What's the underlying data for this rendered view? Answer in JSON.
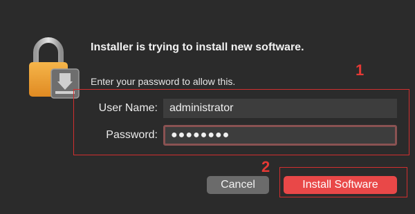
{
  "dialog": {
    "title": "Installer is trying to install new software.",
    "message": "Enter your password to allow this.",
    "icon": "lock-icon"
  },
  "form": {
    "username_label": "User Name:",
    "username_value": "administrator",
    "password_label": "Password:",
    "password_value": "●●●●●●●●"
  },
  "buttons": {
    "cancel_label": "Cancel",
    "install_label": "Install Software"
  },
  "annotations": {
    "step1": "1",
    "step2": "2"
  },
  "colors": {
    "background": "#2b2b2b",
    "accent": "#e94848",
    "annotation": "#d32f2f",
    "lock_body": "#f0a43a"
  }
}
